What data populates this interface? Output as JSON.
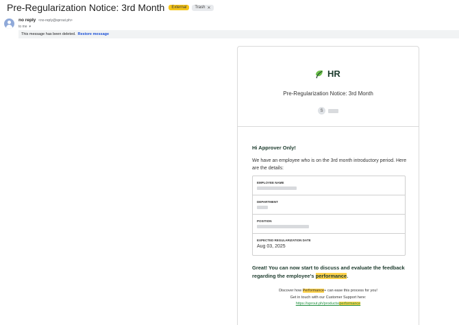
{
  "email": {
    "subject": "Pre-Regularization Notice: 3rd Month",
    "badges": {
      "external": "External",
      "trash": "Trash"
    },
    "sender": {
      "name": "no reply",
      "email": "<no-reply@sprout.ph>",
      "to_label": "to me"
    },
    "deleted_notice": {
      "text": "This message has been deleted.",
      "restore_label": "Restore message"
    }
  },
  "card": {
    "brand": "HR",
    "title": "Pre-Regularization Notice: 3rd Month",
    "user_initial": "S",
    "greeting": "Hi Approver Only!",
    "intro": "We have an employee who is on the 3rd month introductory period. Here are the details:",
    "details": [
      {
        "label": "EMPLOYEE NAME",
        "value": ""
      },
      {
        "label": "DEPARTMENT",
        "value": ""
      },
      {
        "label": "POSITION",
        "value": ""
      },
      {
        "label": "EXPECTED REGULARIZATION DATE",
        "value": "Aug 03, 2025"
      }
    ],
    "closing": {
      "part1": "Great! You can now start to discuss and evaluate the feedback regarding the employee's ",
      "highlight": "performance",
      "part2": "."
    },
    "footer": {
      "line1_pre": "Discover how ",
      "line1_highlight": "Performance",
      "line1_post": "+ can ease this process for you!",
      "line2": "Get in touch with our Customer Support here:",
      "link_pre": "https://sprout.ph/products/",
      "link_highlight": "performance"
    }
  },
  "colors": {
    "accent_green": "#1e8e3e",
    "highlight": "#ffd24c",
    "external_badge": "#f5c518"
  },
  "icons": {
    "brand_logo": "sprout-leaf-icon",
    "avatar": "person-icon"
  }
}
